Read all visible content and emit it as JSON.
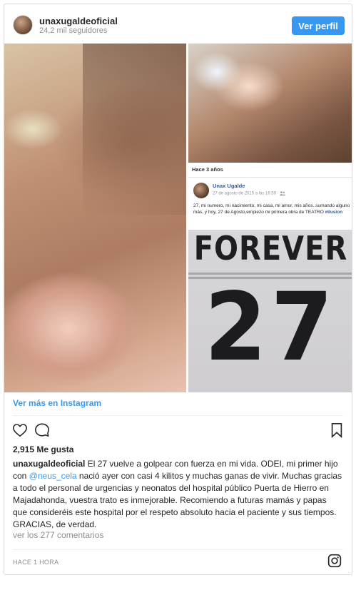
{
  "header": {
    "username": "unaxugaldeoficial",
    "followers": "24,2 mil seguidores",
    "profile_button": "Ver perfil"
  },
  "media": {
    "inset_label": "Hace 3 años",
    "fb_post": {
      "author": "Unax Ugalde",
      "date": "27 de agosto de 2015 a las 16:59 · ",
      "text": "27, mi numero, mi nacimiento, mi casa, mi amor, mis años..sumando alguno más, y hoy, 27 de Agosto,empiezo mi primera obra de TEATRO ",
      "hashtag": "#ilusion"
    },
    "jersey_word": "FOREVER",
    "jersey_number": "27"
  },
  "view_more": "Ver más en Instagram",
  "likes": "2,915 Me gusta",
  "caption": {
    "user": "unaxugaldeoficial",
    "text_before": " El 27 vuelve a golpear con fuerza en mi vida. ODEI, mi primer hijo con ",
    "mention": "@neus_cela",
    "text_after": " nació ayer con casi 4 kilitos y muchas ganas de vivir. Muchas gracias a todo el personal de urgencias y neonatos del hospital público Puerta de Hierro en Majadahonda, vuestra trato es inmejorable. Recomiendo a futuras mamás y papas que consideréis este hospital por el respeto absoluto hacia el paciente y sus tiempos. GRACIAS, de verdad."
  },
  "comments_link": "ver los 277 comentarios",
  "timestamp": "HACE 1 HORA",
  "colors": {
    "accent": "#3897f0",
    "muted": "#8e8e8e",
    "text": "#262626",
    "border": "#dbdbdb"
  },
  "icons": [
    "heart-icon",
    "comment-icon",
    "bookmark-icon",
    "instagram-logo-icon",
    "friends-icon"
  ]
}
